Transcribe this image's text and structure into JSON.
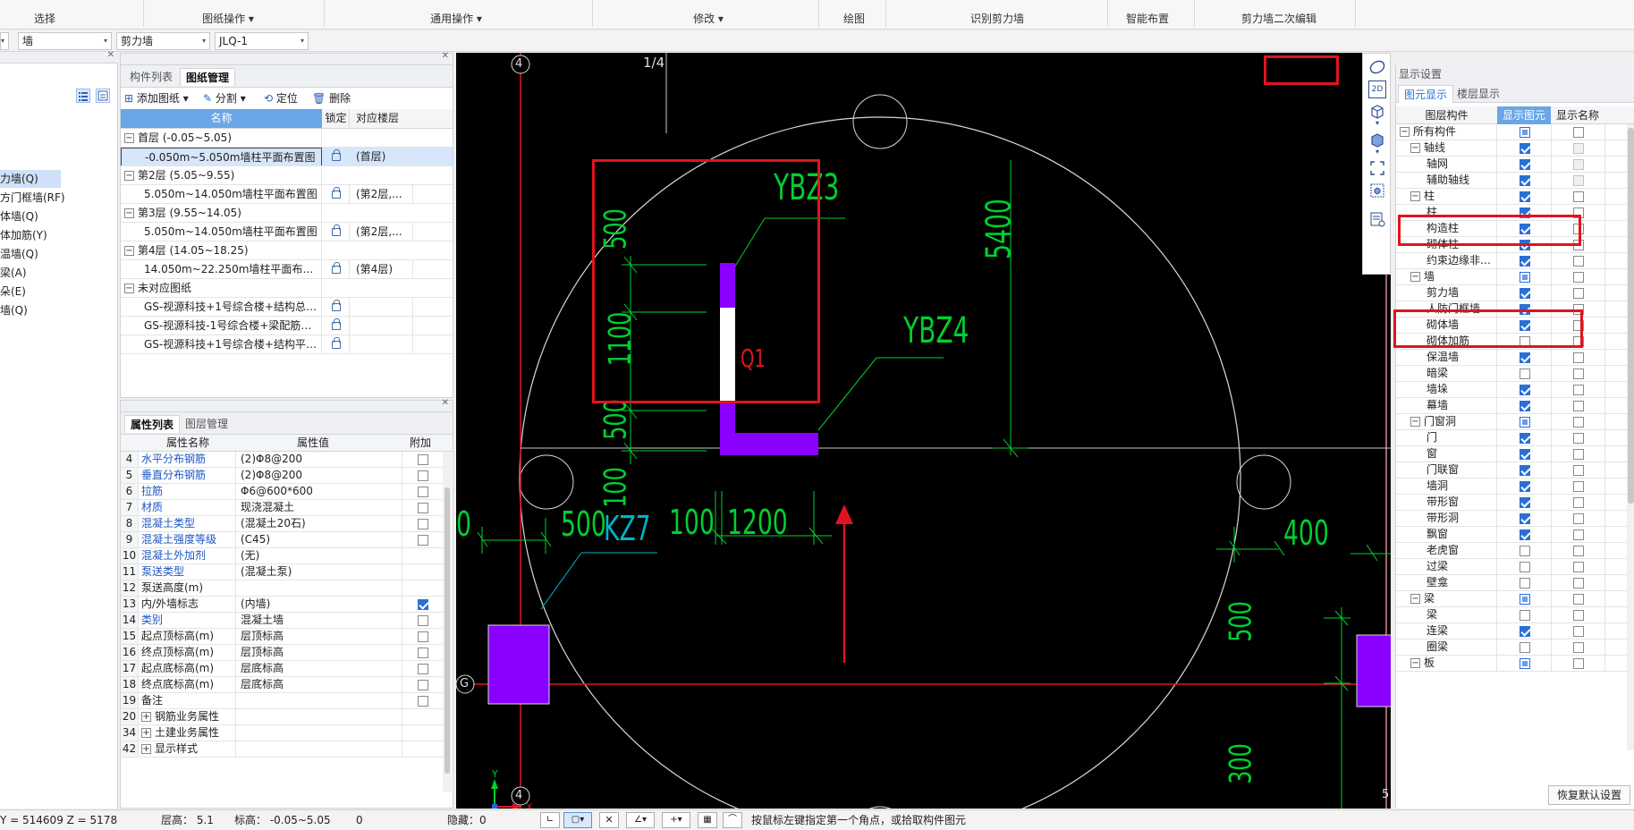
{
  "ribbon": {
    "groups": [
      "选择",
      "图纸操作",
      "通用操作",
      "修改",
      "绘图",
      "识别剪力墙",
      "智能布置",
      "剪力墙二次编辑"
    ]
  },
  "combos": [
    "墙",
    "剪力墙",
    "JLQ-1"
  ],
  "left_nav": {
    "items": [
      "力墙(Q)",
      "方门框墙(RF)",
      "体墙(Q)",
      "体加筋(Y)",
      "温墙(Q)",
      "梁(A)",
      "朵(E)",
      "墙(Q)"
    ]
  },
  "drawing_panel": {
    "tabs": [
      "构件列表",
      "图纸管理"
    ],
    "toolbar": [
      "添加图纸",
      "分割",
      "定位",
      "删除"
    ],
    "columns": [
      "名称",
      "锁定",
      "对应楼层"
    ],
    "rows": [
      {
        "type": "group",
        "name": "首层 (-0.05~5.05)"
      },
      {
        "type": "item",
        "name": "-0.050m~5.050m墙柱平面布置图",
        "floor": "(首层)",
        "selected": true
      },
      {
        "type": "group",
        "name": "第2层 (5.05~9.55)"
      },
      {
        "type": "item",
        "name": "5.050m~14.050m墙柱平面布置图",
        "floor": "(第2层,..."
      },
      {
        "type": "group",
        "name": "第3层 (9.55~14.05)"
      },
      {
        "type": "item",
        "name": "5.050m~14.050m墙柱平面布置图",
        "floor": "(第2层,..."
      },
      {
        "type": "group",
        "name": "第4层 (14.05~18.25)"
      },
      {
        "type": "item",
        "name": "14.050m~22.250m墙柱平面布置图",
        "floor": "(第4层)"
      },
      {
        "type": "group",
        "name": "未对应图纸"
      },
      {
        "type": "item",
        "name": "GS-视源科技+1号综合楼+结构总说明+...",
        "floor": ""
      },
      {
        "type": "item",
        "name": "GS-视源科技-1号综合楼+梁配筋图2021...",
        "floor": ""
      },
      {
        "type": "item",
        "name": "GS-视源科技+1号综合楼+结构平面布置...",
        "floor": ""
      }
    ]
  },
  "property_panel": {
    "tabs": [
      "属性列表",
      "图层管理"
    ],
    "columns": [
      "属性名称",
      "属性值",
      "附加"
    ],
    "rows": [
      {
        "no": "4",
        "name": "水平分布钢筋",
        "value": "(2)Φ8@200",
        "blue": true,
        "check": false
      },
      {
        "no": "5",
        "name": "垂直分布钢筋",
        "value": "(2)Φ8@200",
        "blue": true,
        "check": false
      },
      {
        "no": "6",
        "name": "拉筋",
        "value": "Φ6@600*600",
        "blue": true,
        "check": false
      },
      {
        "no": "7",
        "name": "材质",
        "value": "现浇混凝土",
        "blue": true,
        "check": false
      },
      {
        "no": "8",
        "name": "混凝土类型",
        "value": "(混凝土20石)",
        "blue": true,
        "check": false
      },
      {
        "no": "9",
        "name": "混凝土强度等级",
        "value": "(C45)",
        "blue": true,
        "check": false
      },
      {
        "no": "10",
        "name": "混凝土外加剂",
        "value": "(无)",
        "blue": true,
        "check": null
      },
      {
        "no": "11",
        "name": "泵送类型",
        "value": "(混凝土泵)",
        "blue": true,
        "check": null
      },
      {
        "no": "12",
        "name": "泵送高度(m)",
        "value": "",
        "blue": false,
        "check": null
      },
      {
        "no": "13",
        "name": "内/外墙标志",
        "value": "(内墙)",
        "blue": false,
        "check": true
      },
      {
        "no": "14",
        "name": "类别",
        "value": "混凝土墙",
        "blue": true,
        "check": false
      },
      {
        "no": "15",
        "name": "起点顶标高(m)",
        "value": "层顶标高",
        "blue": false,
        "check": false
      },
      {
        "no": "16",
        "name": "终点顶标高(m)",
        "value": "层顶标高",
        "blue": false,
        "check": false
      },
      {
        "no": "17",
        "name": "起点底标高(m)",
        "value": "层底标高",
        "blue": false,
        "check": false
      },
      {
        "no": "18",
        "name": "终点底标高(m)",
        "value": "层底标高",
        "blue": false,
        "check": false
      },
      {
        "no": "19",
        "name": "备注",
        "value": "",
        "blue": false,
        "check": false
      },
      {
        "no": "20",
        "name": "钢筋业务属性",
        "value": "",
        "blue": false,
        "check": null,
        "expand": true
      },
      {
        "no": "34",
        "name": "土建业务属性",
        "value": "",
        "blue": false,
        "check": null,
        "expand": true
      },
      {
        "no": "42",
        "name": "显示样式",
        "value": "",
        "blue": false,
        "check": null,
        "expand": true
      }
    ]
  },
  "canvas": {
    "labels": {
      "axis4_top": "4",
      "axis4_bottom": "4",
      "axisG": "G",
      "axis5": "5",
      "ratio": "1/4",
      "ybz3": "YBZ3",
      "ybz4": "YBZ4",
      "q1": "Q1",
      "kz7": "KZ7",
      "d500a": "500",
      "d1100": "1100",
      "d500b": "500",
      "d100a": "100",
      "d100b": "100",
      "d1200": "1200",
      "d5400": "5400",
      "d500c": "500",
      "d400": "400",
      "d500d": "500",
      "d300": "300",
      "zero": "0",
      "ucs_y": "Y",
      "ucs_x": "X"
    }
  },
  "display_panel": {
    "title": "显示设置",
    "tabs": [
      "图元显示",
      "楼层显示"
    ],
    "columns": [
      "图层构件",
      "显示图元",
      "显示名称"
    ],
    "rows": [
      {
        "level": 0,
        "label": "所有构件",
        "expand": "−",
        "show": "part",
        "name": "off"
      },
      {
        "level": 1,
        "label": "轴线",
        "expand": "−",
        "show": "on",
        "name": "dis"
      },
      {
        "level": 2,
        "label": "轴网",
        "show": "on",
        "name": "dis"
      },
      {
        "level": 2,
        "label": "辅助轴线",
        "show": "on",
        "name": "dis"
      },
      {
        "level": 1,
        "label": "柱",
        "expand": "−",
        "show": "on",
        "name": "off"
      },
      {
        "level": 2,
        "label": "柱",
        "show": "on",
        "name": "off"
      },
      {
        "level": 2,
        "label": "构造柱",
        "show": "on",
        "name": "off"
      },
      {
        "level": 2,
        "label": "砌体柱",
        "show": "on",
        "name": "off"
      },
      {
        "level": 2,
        "label": "约束边缘非阴...",
        "show": "on",
        "name": "off"
      },
      {
        "level": 1,
        "label": "墙",
        "expand": "−",
        "show": "part",
        "name": "off"
      },
      {
        "level": 2,
        "label": "剪力墙",
        "show": "on",
        "name": "off"
      },
      {
        "level": 2,
        "label": "人防门框墙",
        "show": "on",
        "name": "off"
      },
      {
        "level": 2,
        "label": "砌体墙",
        "show": "on",
        "name": "off"
      },
      {
        "level": 2,
        "label": "砌体加筋",
        "show": "off",
        "name": "off"
      },
      {
        "level": 2,
        "label": "保温墙",
        "show": "on",
        "name": "off"
      },
      {
        "level": 2,
        "label": "暗梁",
        "show": "off",
        "name": "off"
      },
      {
        "level": 2,
        "label": "墙垛",
        "show": "on",
        "name": "off"
      },
      {
        "level": 2,
        "label": "幕墙",
        "show": "on",
        "name": "off"
      },
      {
        "level": 1,
        "label": "门窗洞",
        "expand": "−",
        "show": "part",
        "name": "off"
      },
      {
        "level": 2,
        "label": "门",
        "show": "on",
        "name": "off"
      },
      {
        "level": 2,
        "label": "窗",
        "show": "on",
        "name": "off"
      },
      {
        "level": 2,
        "label": "门联窗",
        "show": "on",
        "name": "off"
      },
      {
        "level": 2,
        "label": "墙洞",
        "show": "on",
        "name": "off"
      },
      {
        "level": 2,
        "label": "带形窗",
        "show": "on",
        "name": "off"
      },
      {
        "level": 2,
        "label": "带形洞",
        "show": "on",
        "name": "off"
      },
      {
        "level": 2,
        "label": "飘窗",
        "show": "on",
        "name": "off"
      },
      {
        "level": 2,
        "label": "老虎窗",
        "show": "off",
        "name": "off"
      },
      {
        "level": 2,
        "label": "过梁",
        "show": "off",
        "name": "off"
      },
      {
        "level": 2,
        "label": "壁龛",
        "show": "off",
        "name": "off"
      },
      {
        "level": 1,
        "label": "梁",
        "expand": "−",
        "show": "part",
        "name": "off"
      },
      {
        "level": 2,
        "label": "梁",
        "show": "off",
        "name": "off"
      },
      {
        "level": 2,
        "label": "连梁",
        "show": "on",
        "name": "off"
      },
      {
        "level": 2,
        "label": "圈梁",
        "show": "off",
        "name": "off"
      },
      {
        "level": 1,
        "label": "板",
        "expand": "−",
        "show": "part",
        "name": "off"
      }
    ],
    "restore_button": "恢复默认设置"
  },
  "status_bar": {
    "coords": "Y = 514609 Z = 5178",
    "floor_height": "层高： 5.1",
    "elevation": "标高： -0.05~5.05",
    "zero": "0",
    "hidden": "隐藏：0",
    "hint": "按鼠标左键指定第一个角点，或拾取构件图元"
  },
  "colors": {
    "canvas_bg": "#000000",
    "wall_purple": "#8a00ff",
    "annotation_green": "#00d030",
    "annotation_cyan": "#00b4c8",
    "axis_red": "#e0141e",
    "highlight_red": "#e0141e"
  }
}
